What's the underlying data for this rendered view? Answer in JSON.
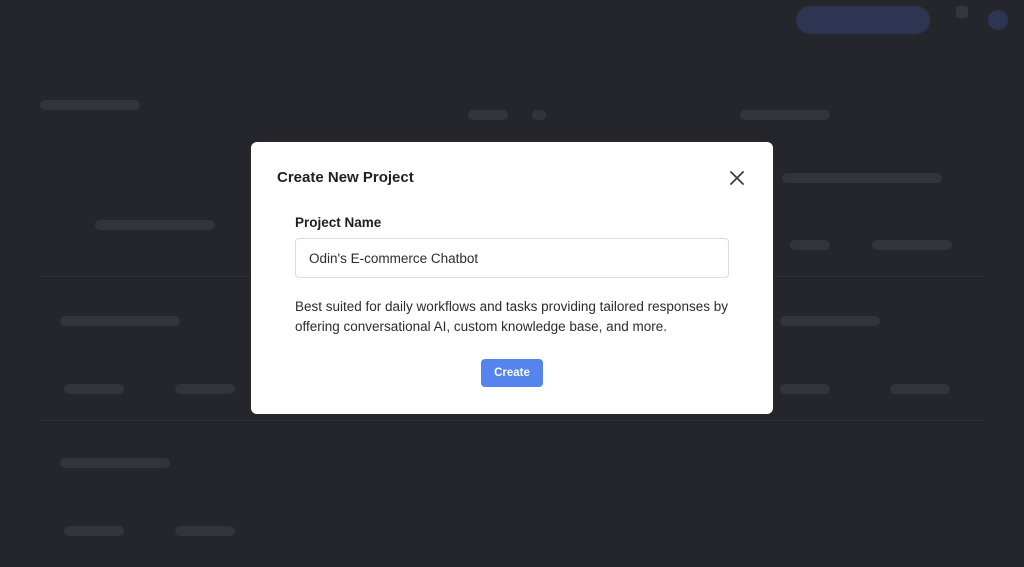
{
  "modal": {
    "title": "Create New Project",
    "close_icon": "close-icon",
    "project_name_label": "Project Name",
    "project_name_value": "Odin's E-commerce Chatbot",
    "description": "Best suited for daily workflows and tasks providing tailored responses by offering conversational AI, custom knowledge base, and more.",
    "create_label": "Create"
  },
  "colors": {
    "overlay": "#25262b",
    "modal_bg": "#ffffff",
    "primary_button": "#5584ef"
  }
}
